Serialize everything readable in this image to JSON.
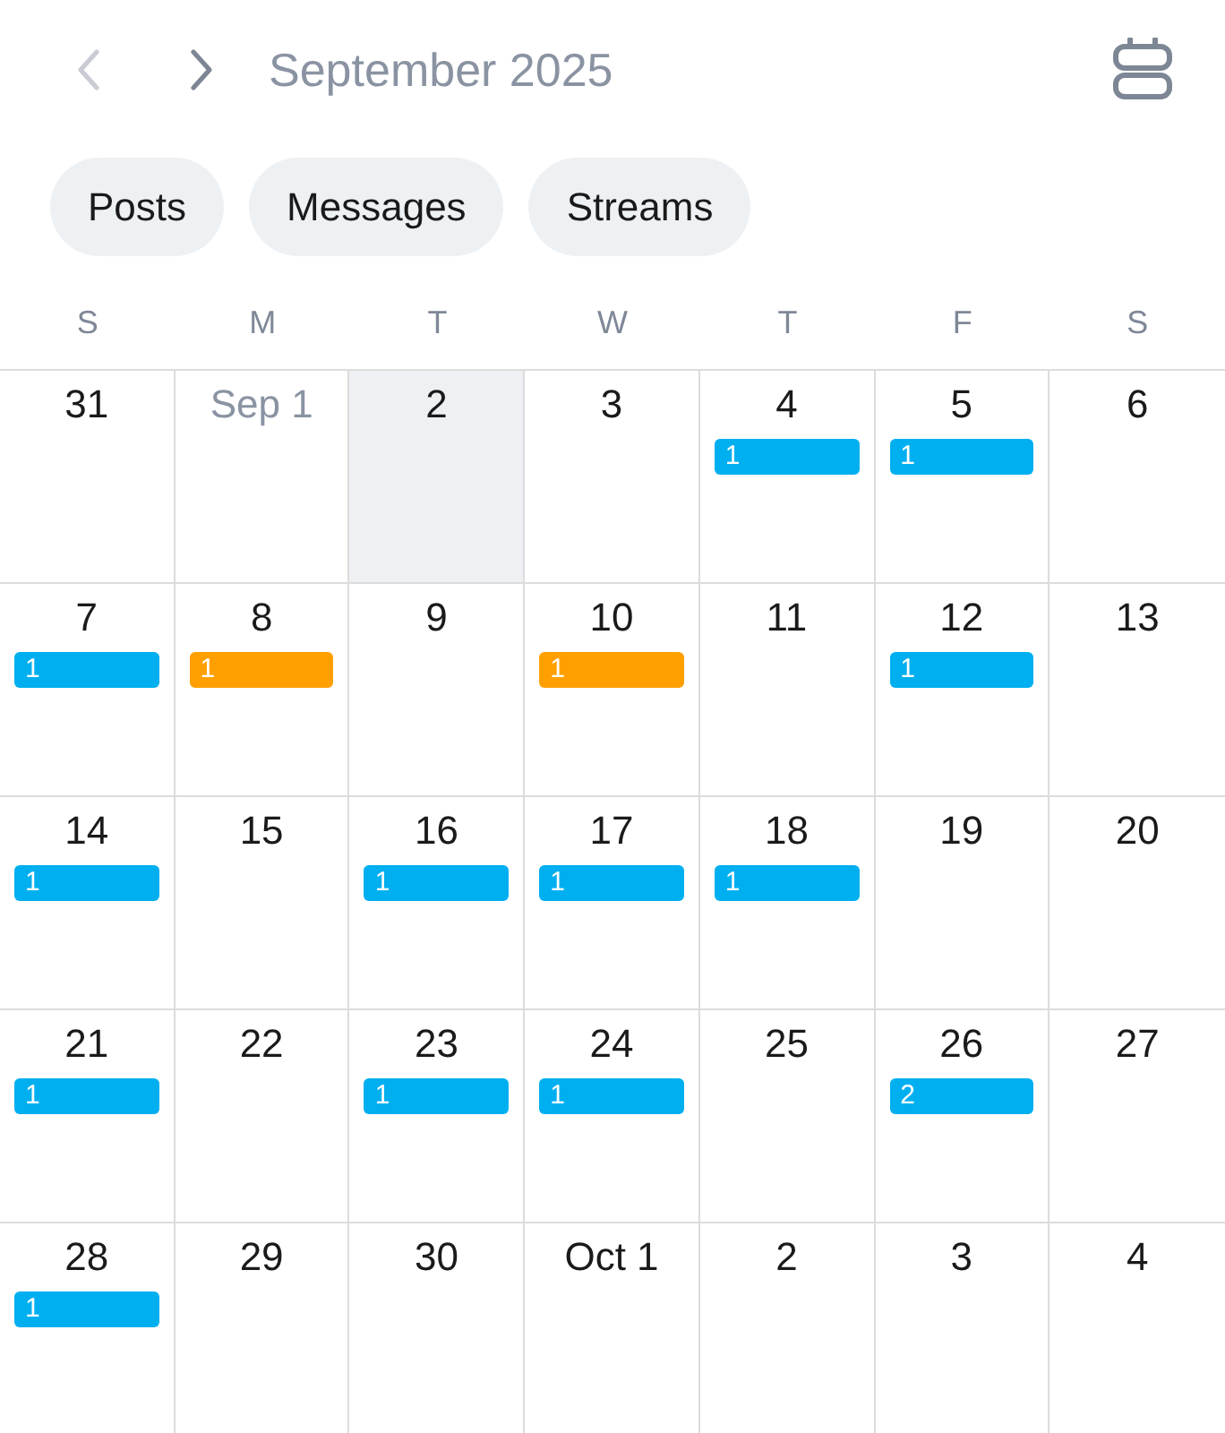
{
  "header": {
    "prev": {
      "disabled": true
    },
    "next": {
      "disabled": false
    },
    "title": "September 2025"
  },
  "filters": [
    {
      "label": "Posts",
      "selected": false
    },
    {
      "label": "Messages",
      "selected": false
    },
    {
      "label": "Streams",
      "selected": false
    }
  ],
  "weekdays": [
    "S",
    "M",
    "T",
    "W",
    "T",
    "F",
    "S"
  ],
  "weeks": [
    {
      "days": [
        {
          "label": "31",
          "muted": false,
          "selected": false
        },
        {
          "label": "Sep 1",
          "muted": true,
          "selected": false
        },
        {
          "label": "2",
          "muted": false,
          "selected": true
        },
        {
          "label": "3",
          "muted": false,
          "selected": false
        },
        {
          "label": "4",
          "muted": false,
          "selected": false,
          "events": [
            {
              "count": "1",
              "color": "#00aff0"
            }
          ]
        },
        {
          "label": "5",
          "muted": false,
          "selected": false,
          "events": [
            {
              "count": "1",
              "color": "#00aff0"
            }
          ]
        },
        {
          "label": "6",
          "muted": false,
          "selected": false
        }
      ]
    },
    {
      "days": [
        {
          "label": "7",
          "muted": false,
          "selected": false,
          "events": [
            {
              "count": "1",
              "color": "#00aff0"
            }
          ]
        },
        {
          "label": "8",
          "muted": false,
          "selected": false,
          "events": [
            {
              "count": "1",
              "color": "#ffa000"
            }
          ]
        },
        {
          "label": "9",
          "muted": false,
          "selected": false
        },
        {
          "label": "10",
          "muted": false,
          "selected": false,
          "events": [
            {
              "count": "1",
              "color": "#ffa000"
            }
          ]
        },
        {
          "label": "11",
          "muted": false,
          "selected": false
        },
        {
          "label": "12",
          "muted": false,
          "selected": false,
          "events": [
            {
              "count": "1",
              "color": "#00aff0"
            }
          ]
        },
        {
          "label": "13",
          "muted": false,
          "selected": false
        }
      ]
    },
    {
      "days": [
        {
          "label": "14",
          "muted": false,
          "selected": false,
          "events": [
            {
              "count": "1",
              "color": "#00aff0"
            }
          ]
        },
        {
          "label": "15",
          "muted": false,
          "selected": false
        },
        {
          "label": "16",
          "muted": false,
          "selected": false,
          "events": [
            {
              "count": "1",
              "color": "#00aff0"
            }
          ]
        },
        {
          "label": "17",
          "muted": false,
          "selected": false,
          "events": [
            {
              "count": "1",
              "color": "#00aff0"
            }
          ]
        },
        {
          "label": "18",
          "muted": false,
          "selected": false,
          "events": [
            {
              "count": "1",
              "color": "#00aff0"
            }
          ]
        },
        {
          "label": "19",
          "muted": false,
          "selected": false
        },
        {
          "label": "20",
          "muted": false,
          "selected": false
        }
      ]
    },
    {
      "days": [
        {
          "label": "21",
          "muted": false,
          "selected": false,
          "events": [
            {
              "count": "1",
              "color": "#00aff0"
            }
          ]
        },
        {
          "label": "22",
          "muted": false,
          "selected": false
        },
        {
          "label": "23",
          "muted": false,
          "selected": false,
          "events": [
            {
              "count": "1",
              "color": "#00aff0"
            }
          ]
        },
        {
          "label": "24",
          "muted": false,
          "selected": false,
          "events": [
            {
              "count": "1",
              "color": "#00aff0"
            }
          ]
        },
        {
          "label": "25",
          "muted": false,
          "selected": false
        },
        {
          "label": "26",
          "muted": false,
          "selected": false,
          "events": [
            {
              "count": "2",
              "color": "#00aff0"
            }
          ]
        },
        {
          "label": "27",
          "muted": false,
          "selected": false
        }
      ]
    },
    {
      "days": [
        {
          "label": "28",
          "muted": false,
          "selected": false,
          "events": [
            {
              "count": "1",
              "color": "#00aff0"
            }
          ]
        },
        {
          "label": "29",
          "muted": false,
          "selected": false
        },
        {
          "label": "30",
          "muted": false,
          "selected": false
        },
        {
          "label": "Oct 1",
          "muted": false,
          "selected": false
        },
        {
          "label": "2",
          "muted": false,
          "selected": false
        },
        {
          "label": "3",
          "muted": false,
          "selected": false
        },
        {
          "label": "4",
          "muted": false,
          "selected": false
        }
      ]
    }
  ]
}
